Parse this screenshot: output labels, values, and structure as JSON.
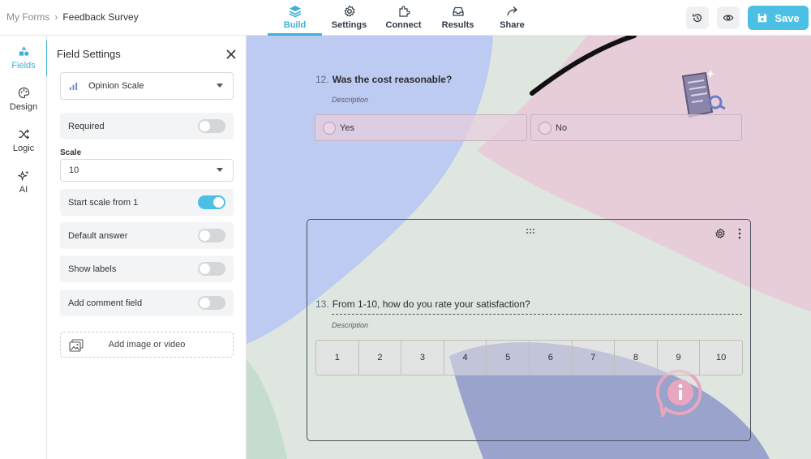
{
  "breadcrumb": {
    "root": "My Forms",
    "separator": "›",
    "current": "Feedback Survey"
  },
  "tabs": [
    {
      "label": "Build",
      "icon": "layers-icon",
      "active": true
    },
    {
      "label": "Settings",
      "icon": "gear-icon",
      "active": false
    },
    {
      "label": "Connect",
      "icon": "puzzle-icon",
      "active": false
    },
    {
      "label": "Results",
      "icon": "inbox-icon",
      "active": false
    },
    {
      "label": "Share",
      "icon": "share-arrow-icon",
      "active": false
    }
  ],
  "toolbar": {
    "save_label": "Save"
  },
  "rail": [
    {
      "label": "Fields",
      "icon": "shapes-icon",
      "active": true
    },
    {
      "label": "Design",
      "icon": "palette-icon",
      "active": false
    },
    {
      "label": "Logic",
      "icon": "shuffle-icon",
      "active": false
    },
    {
      "label": "AI",
      "icon": "sparkles-icon",
      "active": false
    }
  ],
  "panel": {
    "title": "Field Settings",
    "field_type": "Opinion Scale",
    "required_label": "Required",
    "required": false,
    "scale_label": "Scale",
    "scale_value": "10",
    "start_from_one_label": "Start scale from 1",
    "start_from_one": true,
    "default_answer_label": "Default answer",
    "default_answer": false,
    "show_labels_label": "Show labels",
    "show_labels": false,
    "comment_field_label": "Add comment field",
    "comment_field": false,
    "add_media_label": "Add image or video"
  },
  "form": {
    "q12": {
      "number": "12.",
      "text": "Was the cost reasonable?",
      "description": "Description",
      "choices": [
        "Yes",
        "No"
      ]
    },
    "q13": {
      "number": "13.",
      "text": "From 1-10, how do you rate your satisfaction?",
      "description": "Description",
      "scale": [
        "1",
        "2",
        "3",
        "4",
        "5",
        "6",
        "7",
        "8",
        "9",
        "10"
      ]
    }
  },
  "colors": {
    "accent": "#4bc0e4",
    "canvas_green": "#dfe6e0",
    "shape_blue": "#bdcaf2",
    "shape_pink": "#e7cdd9",
    "shape_indigo": "#9aa3cc"
  }
}
